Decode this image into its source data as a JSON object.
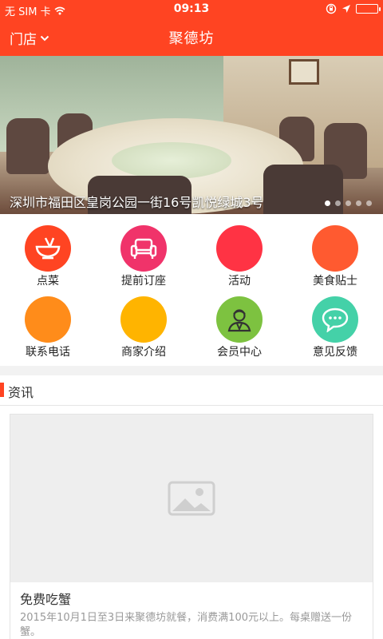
{
  "status": {
    "carrier": "无 SIM 卡",
    "time": "09:13"
  },
  "header": {
    "store_label": "门店",
    "title": "聚德坊"
  },
  "banner": {
    "caption": "深圳市福田区皇岗公园一街16号凯悦绿城3号",
    "slide_count": 5,
    "active_slide": 1
  },
  "grid": [
    {
      "label": "点菜",
      "color": "#ff4422",
      "icon": "bowl-icon"
    },
    {
      "label": "提前订座",
      "color": "#f0336a",
      "icon": "sofa-icon"
    },
    {
      "label": "活动",
      "color": "#ff3344",
      "icon": ""
    },
    {
      "label": "美食贴士",
      "color": "#ff5a30",
      "icon": ""
    },
    {
      "label": "联系电话",
      "color": "#ff8c1a",
      "icon": ""
    },
    {
      "label": "商家介绍",
      "color": "#ffb400",
      "icon": ""
    },
    {
      "label": "会员中心",
      "color": "#7dc240",
      "icon": "person-icon"
    },
    {
      "label": "意见反馈",
      "color": "#44d1a8",
      "icon": "chat-bubble-icon"
    }
  ],
  "news": {
    "section_title": "资讯",
    "items": [
      {
        "title": "免费吃蟹",
        "desc": "2015年10月1日至3日来聚德坊就餐，消费满100元以上。每桌赠送一份蟹。"
      }
    ]
  }
}
